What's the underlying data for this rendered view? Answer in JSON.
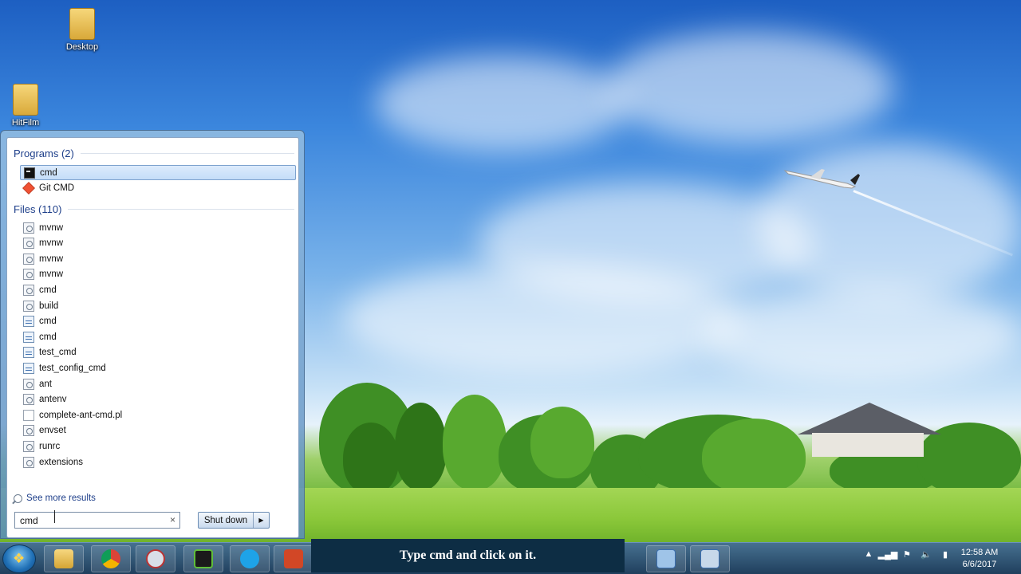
{
  "desktop": {
    "icons": [
      {
        "label": "Desktop"
      },
      {
        "label": "HitFilm"
      }
    ]
  },
  "start_menu": {
    "programs_header": "Programs (2)",
    "programs": [
      {
        "label": "cmd",
        "icon": "cmd-console-icon",
        "selected": true
      },
      {
        "label": "Git CMD",
        "icon": "git-icon"
      }
    ],
    "files_header": "Files (110)",
    "files": [
      {
        "label": "mvnw",
        "icon": "settings-file-icon"
      },
      {
        "label": "mvnw",
        "icon": "settings-file-icon"
      },
      {
        "label": "mvnw",
        "icon": "settings-file-icon"
      },
      {
        "label": "mvnw",
        "icon": "settings-file-icon"
      },
      {
        "label": "cmd",
        "icon": "settings-file-icon"
      },
      {
        "label": "build",
        "icon": "settings-file-icon"
      },
      {
        "label": "cmd",
        "icon": "script-file-icon"
      },
      {
        "label": "cmd",
        "icon": "script-file-icon"
      },
      {
        "label": "test_cmd",
        "icon": "script-file-icon"
      },
      {
        "label": "test_config_cmd",
        "icon": "script-file-icon"
      },
      {
        "label": "ant",
        "icon": "settings-file-icon"
      },
      {
        "label": "antenv",
        "icon": "settings-file-icon"
      },
      {
        "label": "complete-ant-cmd.pl",
        "icon": "blank-file-icon"
      },
      {
        "label": "envset",
        "icon": "settings-file-icon"
      },
      {
        "label": "runrc",
        "icon": "settings-file-icon"
      },
      {
        "label": "extensions",
        "icon": "settings-file-icon"
      }
    ],
    "see_more": "See more results",
    "search_value": "cmd",
    "search_clear": "×",
    "shutdown_label": "Shut down",
    "shutdown_arrow": "▶"
  },
  "taskbar": {
    "caption": "Type cmd and click on it.",
    "clock_time": "12:58 AM",
    "clock_date": "6/6/2017",
    "tray_icons": [
      "show-hidden-icon",
      "network-icon",
      "flag-icon",
      "volume-icon",
      "battery-icon"
    ],
    "tray_glyphs": [
      "▲",
      "▂▄▆",
      "⚑",
      "🔈",
      "▮"
    ],
    "pinned": [
      "file-explorer-icon",
      "chrome-icon",
      "snipping-tool-icon",
      "console-app-icon",
      "skype-icon",
      "powerpoint-icon"
    ]
  },
  "colors": {
    "selection": "#c4ddf8",
    "group_header": "#1e3f8a",
    "caption_bg": "#0d2d44"
  }
}
